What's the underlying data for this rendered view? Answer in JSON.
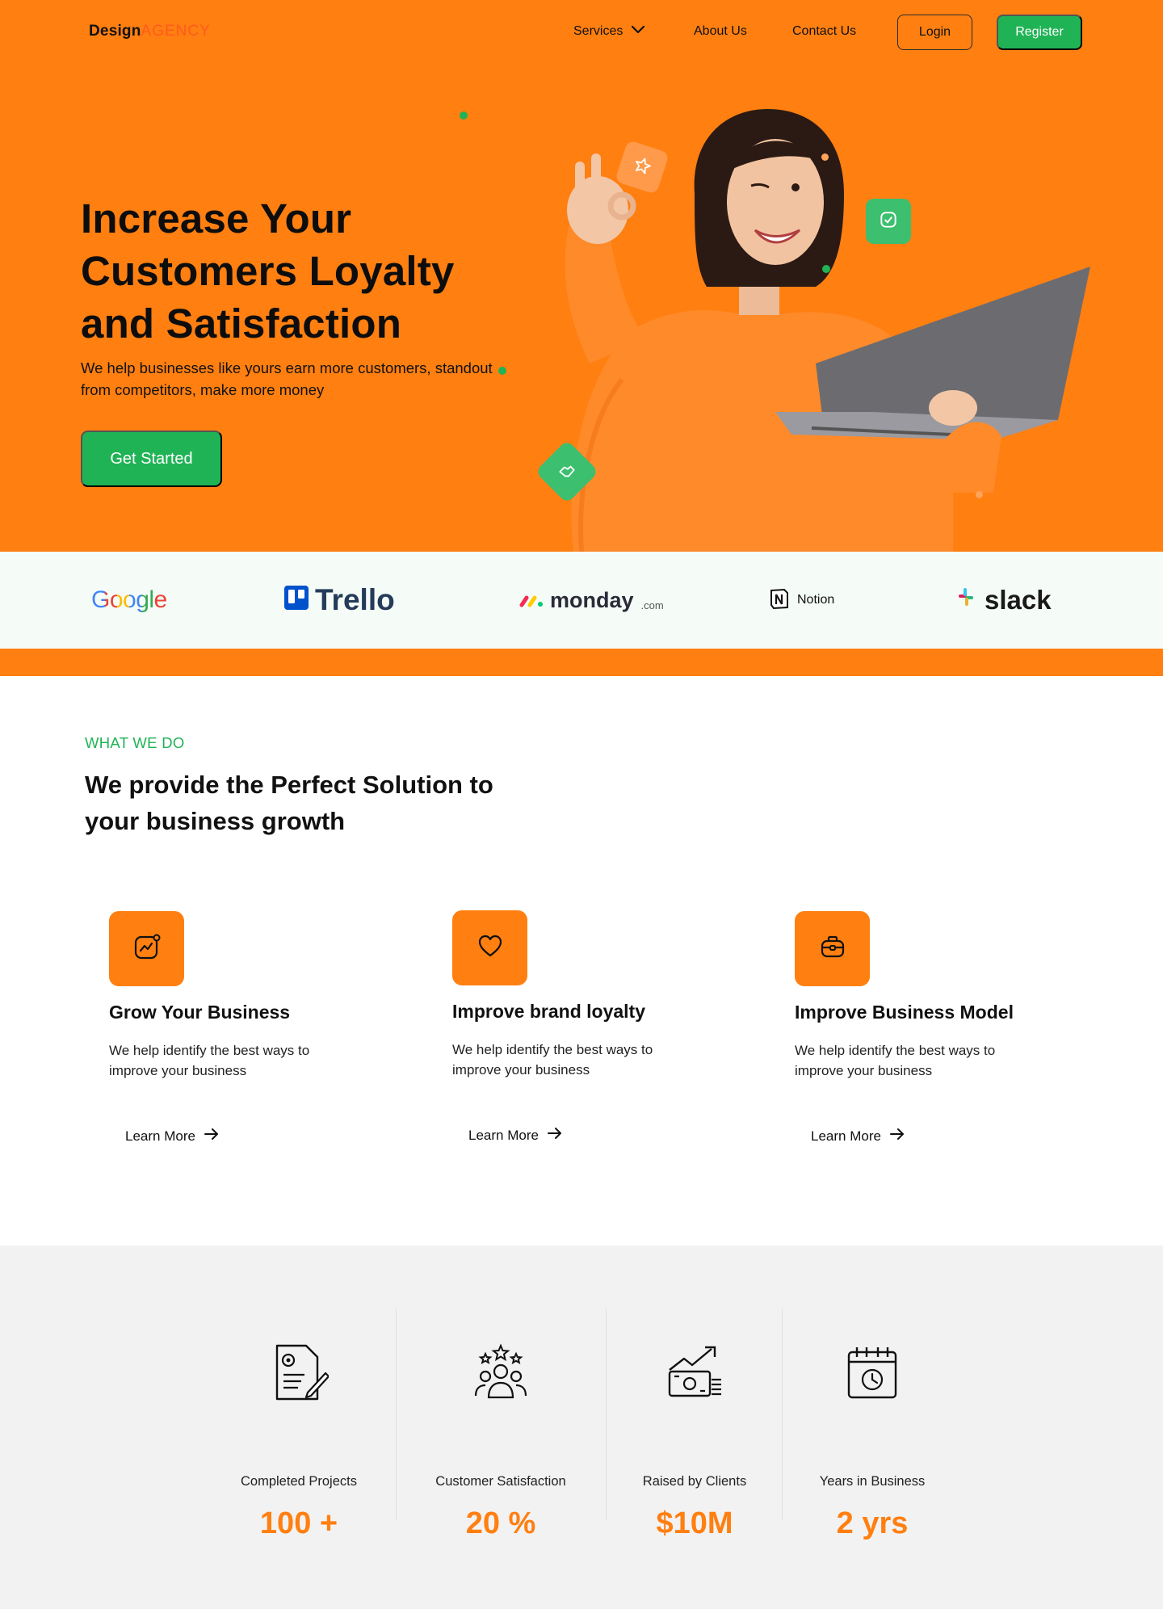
{
  "brand": {
    "name_part1": "Design",
    "name_part2": "AGENCY"
  },
  "nav": {
    "services": "Services",
    "about": "About Us",
    "contact": "Contact Us",
    "login": "Login",
    "register": "Register"
  },
  "hero": {
    "title": "Increase Your Customers Loyalty and Satisfaction",
    "subtitle": "We help businesses like yours earn more customers, standout from competitors,  make more money",
    "cta": "Get Started"
  },
  "brands": {
    "google": "Google",
    "trello": "Trello",
    "monday": "monday",
    "monday_suffix": ".com",
    "notion": "Notion",
    "slack": "slack"
  },
  "what_we_do": {
    "eyebrow": "WHAT WE DO",
    "title": "We provide the Perfect Solution to your business growth",
    "cards": [
      {
        "icon": "growth-chart-icon",
        "title": "Grow Your Business",
        "desc": "We help identify the best ways to improve your business",
        "link": "Learn More"
      },
      {
        "icon": "heart-icon",
        "title": "Improve brand loyalty",
        "desc": "We help identify the best ways to improve your business",
        "link": "Learn More"
      },
      {
        "icon": "briefcase-icon",
        "title": "Improve Business Model",
        "desc": "We help identify the best ways to improve your business",
        "link": "Learn More"
      }
    ]
  },
  "stats": [
    {
      "icon": "document-gear-icon",
      "label": "Completed Projects",
      "value": "100 +"
    },
    {
      "icon": "team-stars-icon",
      "label": "Customer Satisfaction",
      "value": "20 %"
    },
    {
      "icon": "money-growth-icon",
      "label": "Raised by Clients",
      "value": "$10M"
    },
    {
      "icon": "calendar-clock-icon",
      "label": "Years in Business",
      "value": "2 yrs"
    }
  ],
  "colors": {
    "primary": "#FF7F11",
    "accent": "#20B356",
    "logo_strip_bg": "#F5FCF7",
    "stats_bg": "#F2F2F2"
  }
}
